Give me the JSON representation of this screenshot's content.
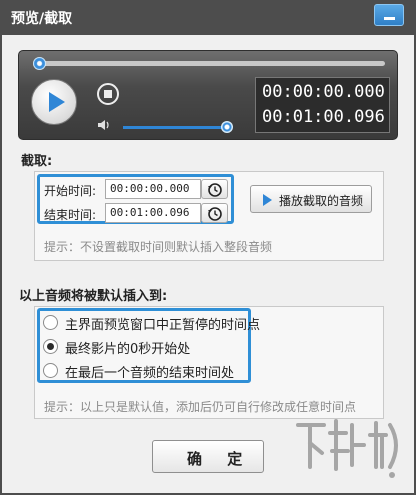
{
  "window": {
    "title": "预览/截取"
  },
  "player": {
    "progress": 0.0,
    "volume": 1.0,
    "current_time": "00:00:00.000",
    "total_time": "00:01:00.096"
  },
  "capture": {
    "section_label": "截取:",
    "start_label": "开始时间:",
    "start_value": "00:00:00.000",
    "end_label": "结束时间:",
    "end_value": "00:01:00.096",
    "play_button": "播放截取的音频",
    "hint": "提示：不设置截取时间则默认插入整段音频"
  },
  "insert": {
    "section_label": "以上音频将被默认插入到:",
    "options": [
      {
        "label": "主界面预览窗口中正暂停的时间点",
        "checked": false
      },
      {
        "label": "最终影片的0秒开始处",
        "checked": true
      },
      {
        "label": "在最后一个音频的结束时间处",
        "checked": false
      }
    ],
    "hint": "提示：以上只是默认值，添加后仍可自行修改成任意时间点"
  },
  "ok_button": "确 定",
  "watermark": "下载吧",
  "colors": {
    "accent": "#2f8fd6",
    "titlebar": "#4d4d4d"
  }
}
